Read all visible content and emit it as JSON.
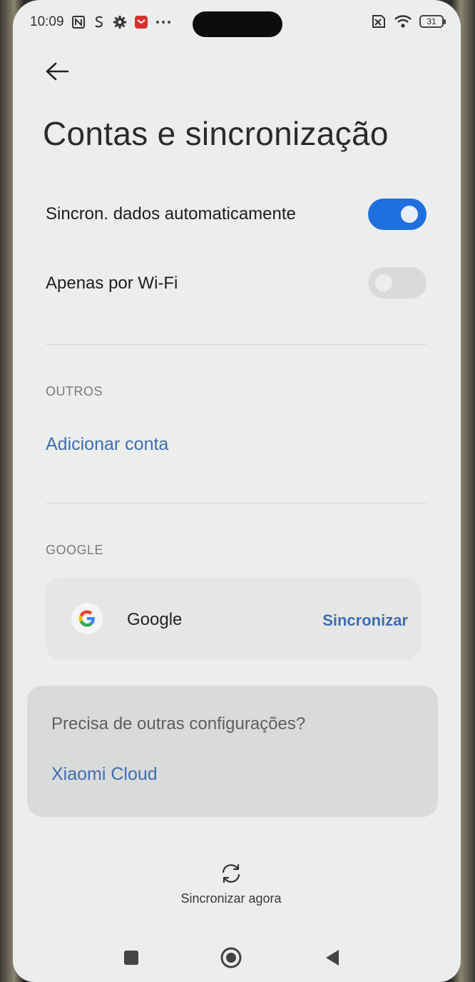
{
  "status_bar": {
    "time": "10:09",
    "left_icons": [
      "nfc-icon",
      "sim-icon",
      "settings-gear-icon",
      "notification-app-icon",
      "more-dots-icon"
    ],
    "right_icons": [
      "sim-off-icon",
      "wifi-icon"
    ],
    "battery": "31"
  },
  "header": {
    "title": "Contas e sincronização"
  },
  "settings": {
    "auto_sync_label": "Sincron. dados automaticamente",
    "auto_sync_on": true,
    "wifi_only_label": "Apenas por Wi-Fi",
    "wifi_only_on": false
  },
  "others_section": {
    "header": "OUTROS",
    "add_account": "Adicionar conta"
  },
  "google_section": {
    "header": "GOOGLE",
    "account_name": "Google",
    "sync_label": "Sincronizar"
  },
  "cloud_card": {
    "question": "Precisa de outras configurações?",
    "link": "Xiaomi Cloud"
  },
  "footer": {
    "sync_now": "Sincronizar agora"
  },
  "colors": {
    "accent": "#1f6fde",
    "link": "#3f6db3",
    "background": "#eceeed"
  }
}
